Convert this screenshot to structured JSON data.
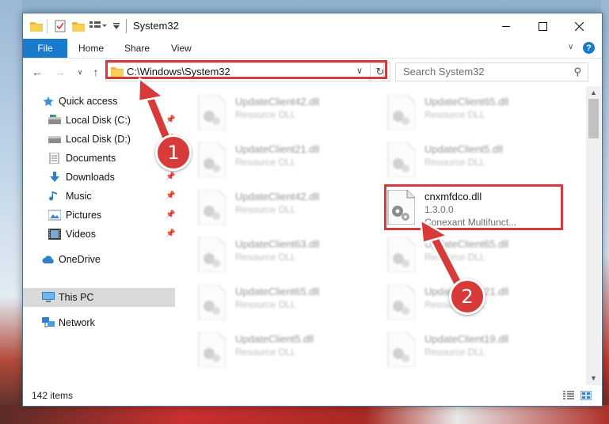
{
  "window": {
    "title": "System32"
  },
  "ribbon": {
    "tabs": [
      "File",
      "Home",
      "Share",
      "View"
    ]
  },
  "address": {
    "path": "C:\\Windows\\System32"
  },
  "search": {
    "placeholder": "Search System32"
  },
  "sidebar": {
    "items": [
      {
        "label": "Quick access",
        "icon": "star-icon"
      },
      {
        "label": "Local Disk (C:)",
        "icon": "drive-icon"
      },
      {
        "label": "Local Disk (D:)",
        "icon": "drive-icon"
      },
      {
        "label": "Documents",
        "icon": "documents-icon"
      },
      {
        "label": "Downloads",
        "icon": "download-icon"
      },
      {
        "label": "Music",
        "icon": "music-icon"
      },
      {
        "label": "Pictures",
        "icon": "pictures-icon"
      },
      {
        "label": "Videos",
        "icon": "videos-icon"
      },
      {
        "label": "OneDrive",
        "icon": "cloud-icon"
      },
      {
        "label": "This PC",
        "icon": "computer-icon"
      },
      {
        "label": "Network",
        "icon": "network-icon"
      }
    ]
  },
  "files": [
    {
      "name": "UpdateClient42.dll",
      "line2": "Resource DLL"
    },
    {
      "name": "UpdateClient65.dll",
      "line2": "Resource DLL"
    },
    {
      "name": "UpdateClient21.dll",
      "line2": "Resource DLL"
    },
    {
      "name": "UpdateClient5.dll",
      "line2": "Resource DLL"
    },
    {
      "name": "UpdateClient42.dll",
      "line2": "Resource DLL"
    },
    {
      "name": "cnxmfdco.dll",
      "line2": "1.3.0.0",
      "line3": "Conexant Multifunct..."
    },
    {
      "name": "UpdateClient63.dll",
      "line2": "Resource DLL"
    },
    {
      "name": "UpdateClient65.dll",
      "line2": "Resource DLL"
    },
    {
      "name": "UpdateClient65.dll",
      "line2": "Resource DLL"
    },
    {
      "name": "UpdateClient21.dll",
      "line2": "Resource DLL"
    },
    {
      "name": "UpdateClient5.dll",
      "line2": "Resource DLL"
    },
    {
      "name": "UpdateClient19.dll",
      "line2": "Resource DLL"
    }
  ],
  "status": {
    "count": "142 items"
  },
  "annotations": {
    "step1": "1",
    "step2": "2"
  },
  "colors": {
    "accent": "#1979ca",
    "annotation": "#d83a3a"
  }
}
